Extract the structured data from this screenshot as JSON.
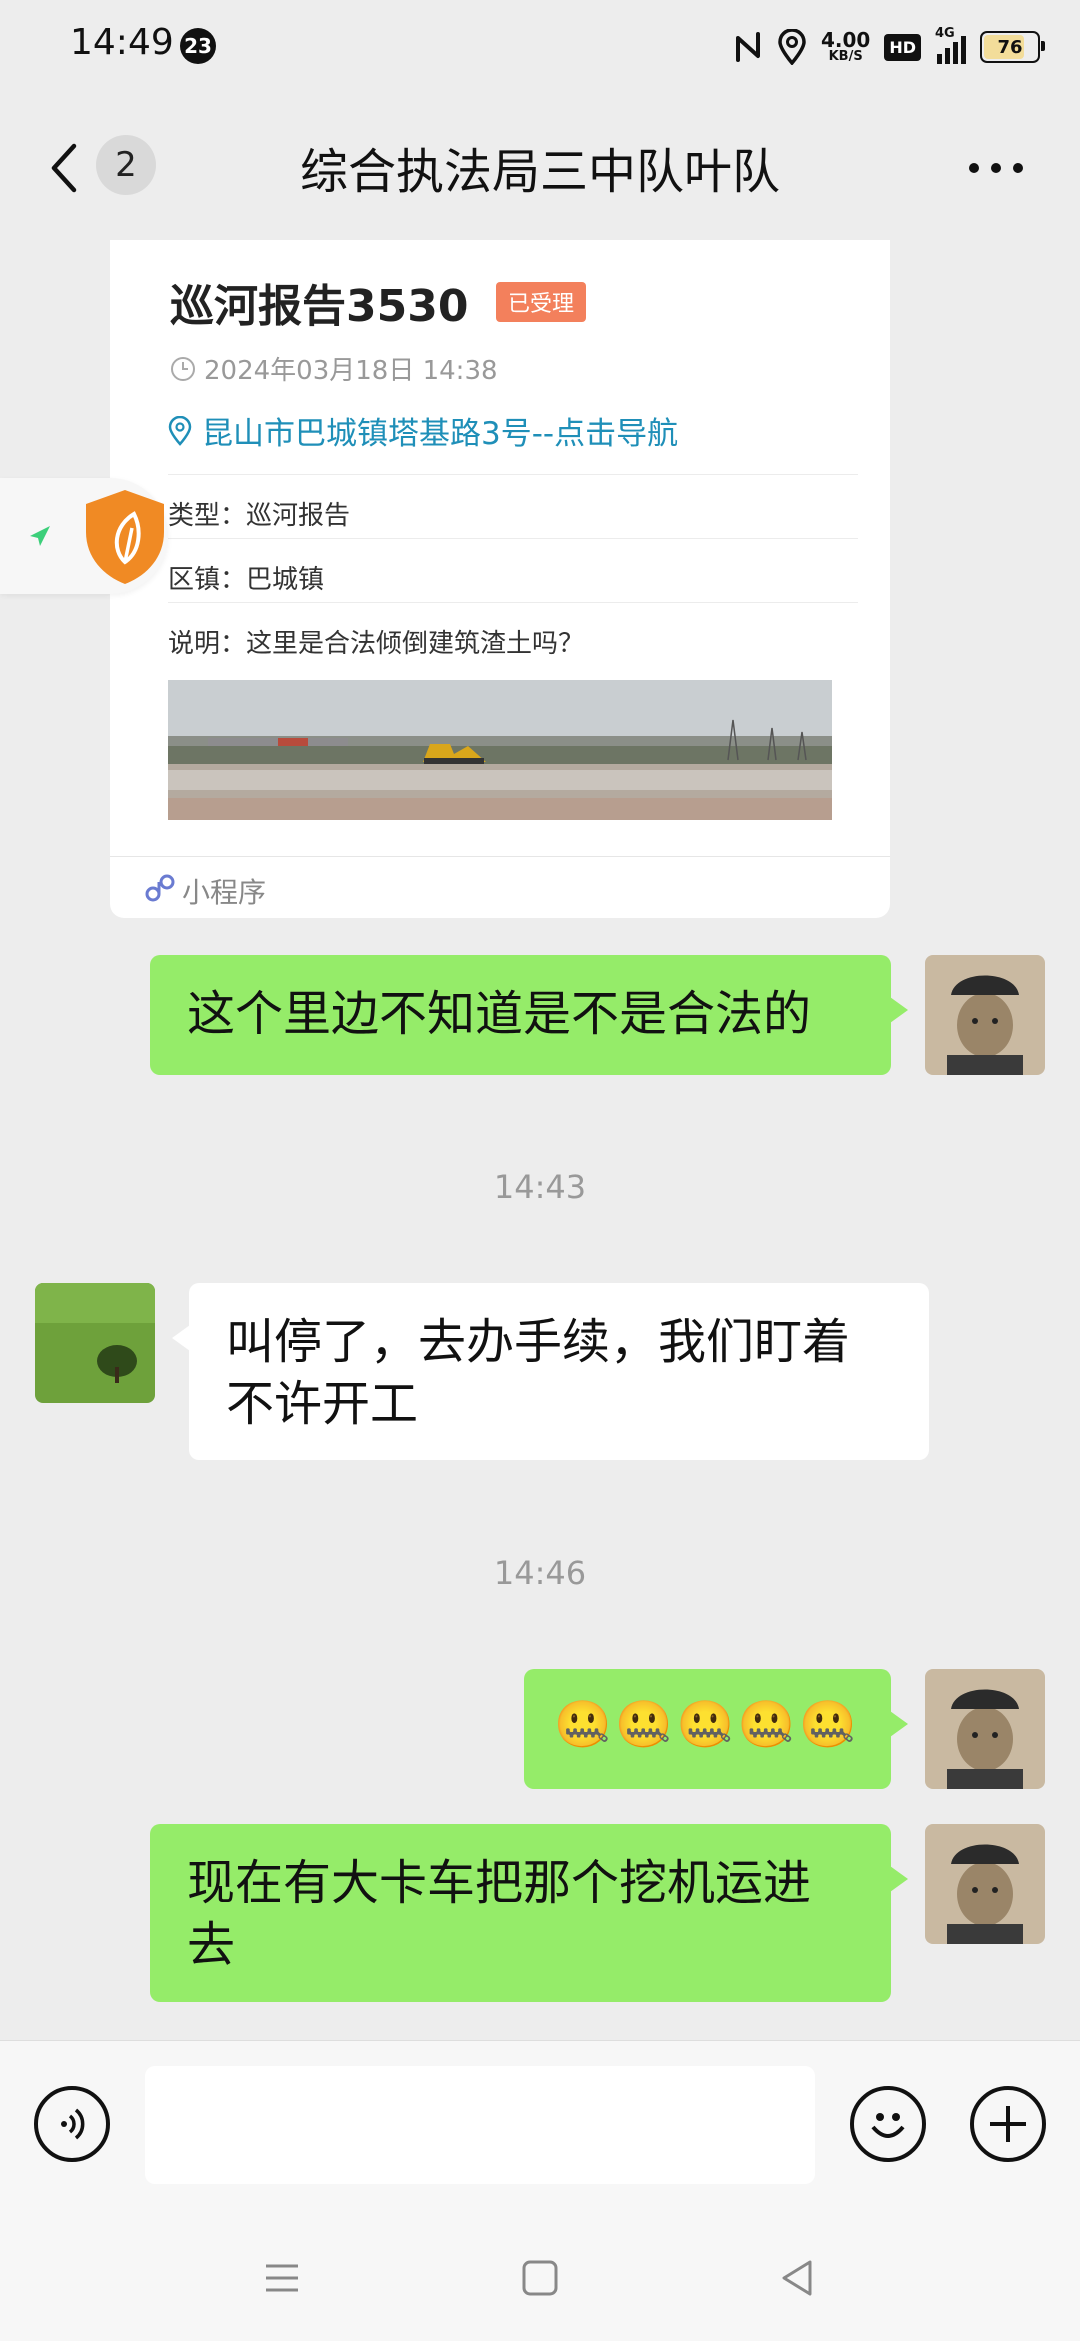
{
  "status_bar": {
    "time": "14:49",
    "notification_count": "23",
    "net_speed_value": "4.00",
    "net_speed_unit": "KB/S",
    "hd_label": "HD",
    "network_label": "4G",
    "battery": "76"
  },
  "header": {
    "unread_count": "2",
    "title": "综合执法局三中队叶队",
    "more_icon": "more-icon"
  },
  "card": {
    "title": "巡河报告3530",
    "badge": "已受理",
    "datetime": "2024年03月18日 14:38",
    "address": "昆山市巴城镇塔基路3号--点击导航",
    "rows": [
      {
        "label": "类型：",
        "value": "巡河报告"
      },
      {
        "label": "区镇：",
        "value": "巴城镇"
      },
      {
        "label": "说明：",
        "value": "这里是合法倾倒建筑渣土吗？"
      }
    ],
    "footer_label": "小程序"
  },
  "messages": {
    "m1": "这个里边不知道是不是合法的",
    "ts1": "14:43",
    "m2": "叫停了，去办手续，我们盯着不许开工",
    "ts2": "14:46",
    "m3": "🤐🤐🤐🤐🤐",
    "m4": "现在有大卡车把那个挖机运进去"
  },
  "colors": {
    "sent_bubble": "#95ec69",
    "received_bubble": "#ffffff",
    "accent_link": "#1f8fb8",
    "badge": "#f3805c",
    "shield": "#f08a24"
  }
}
